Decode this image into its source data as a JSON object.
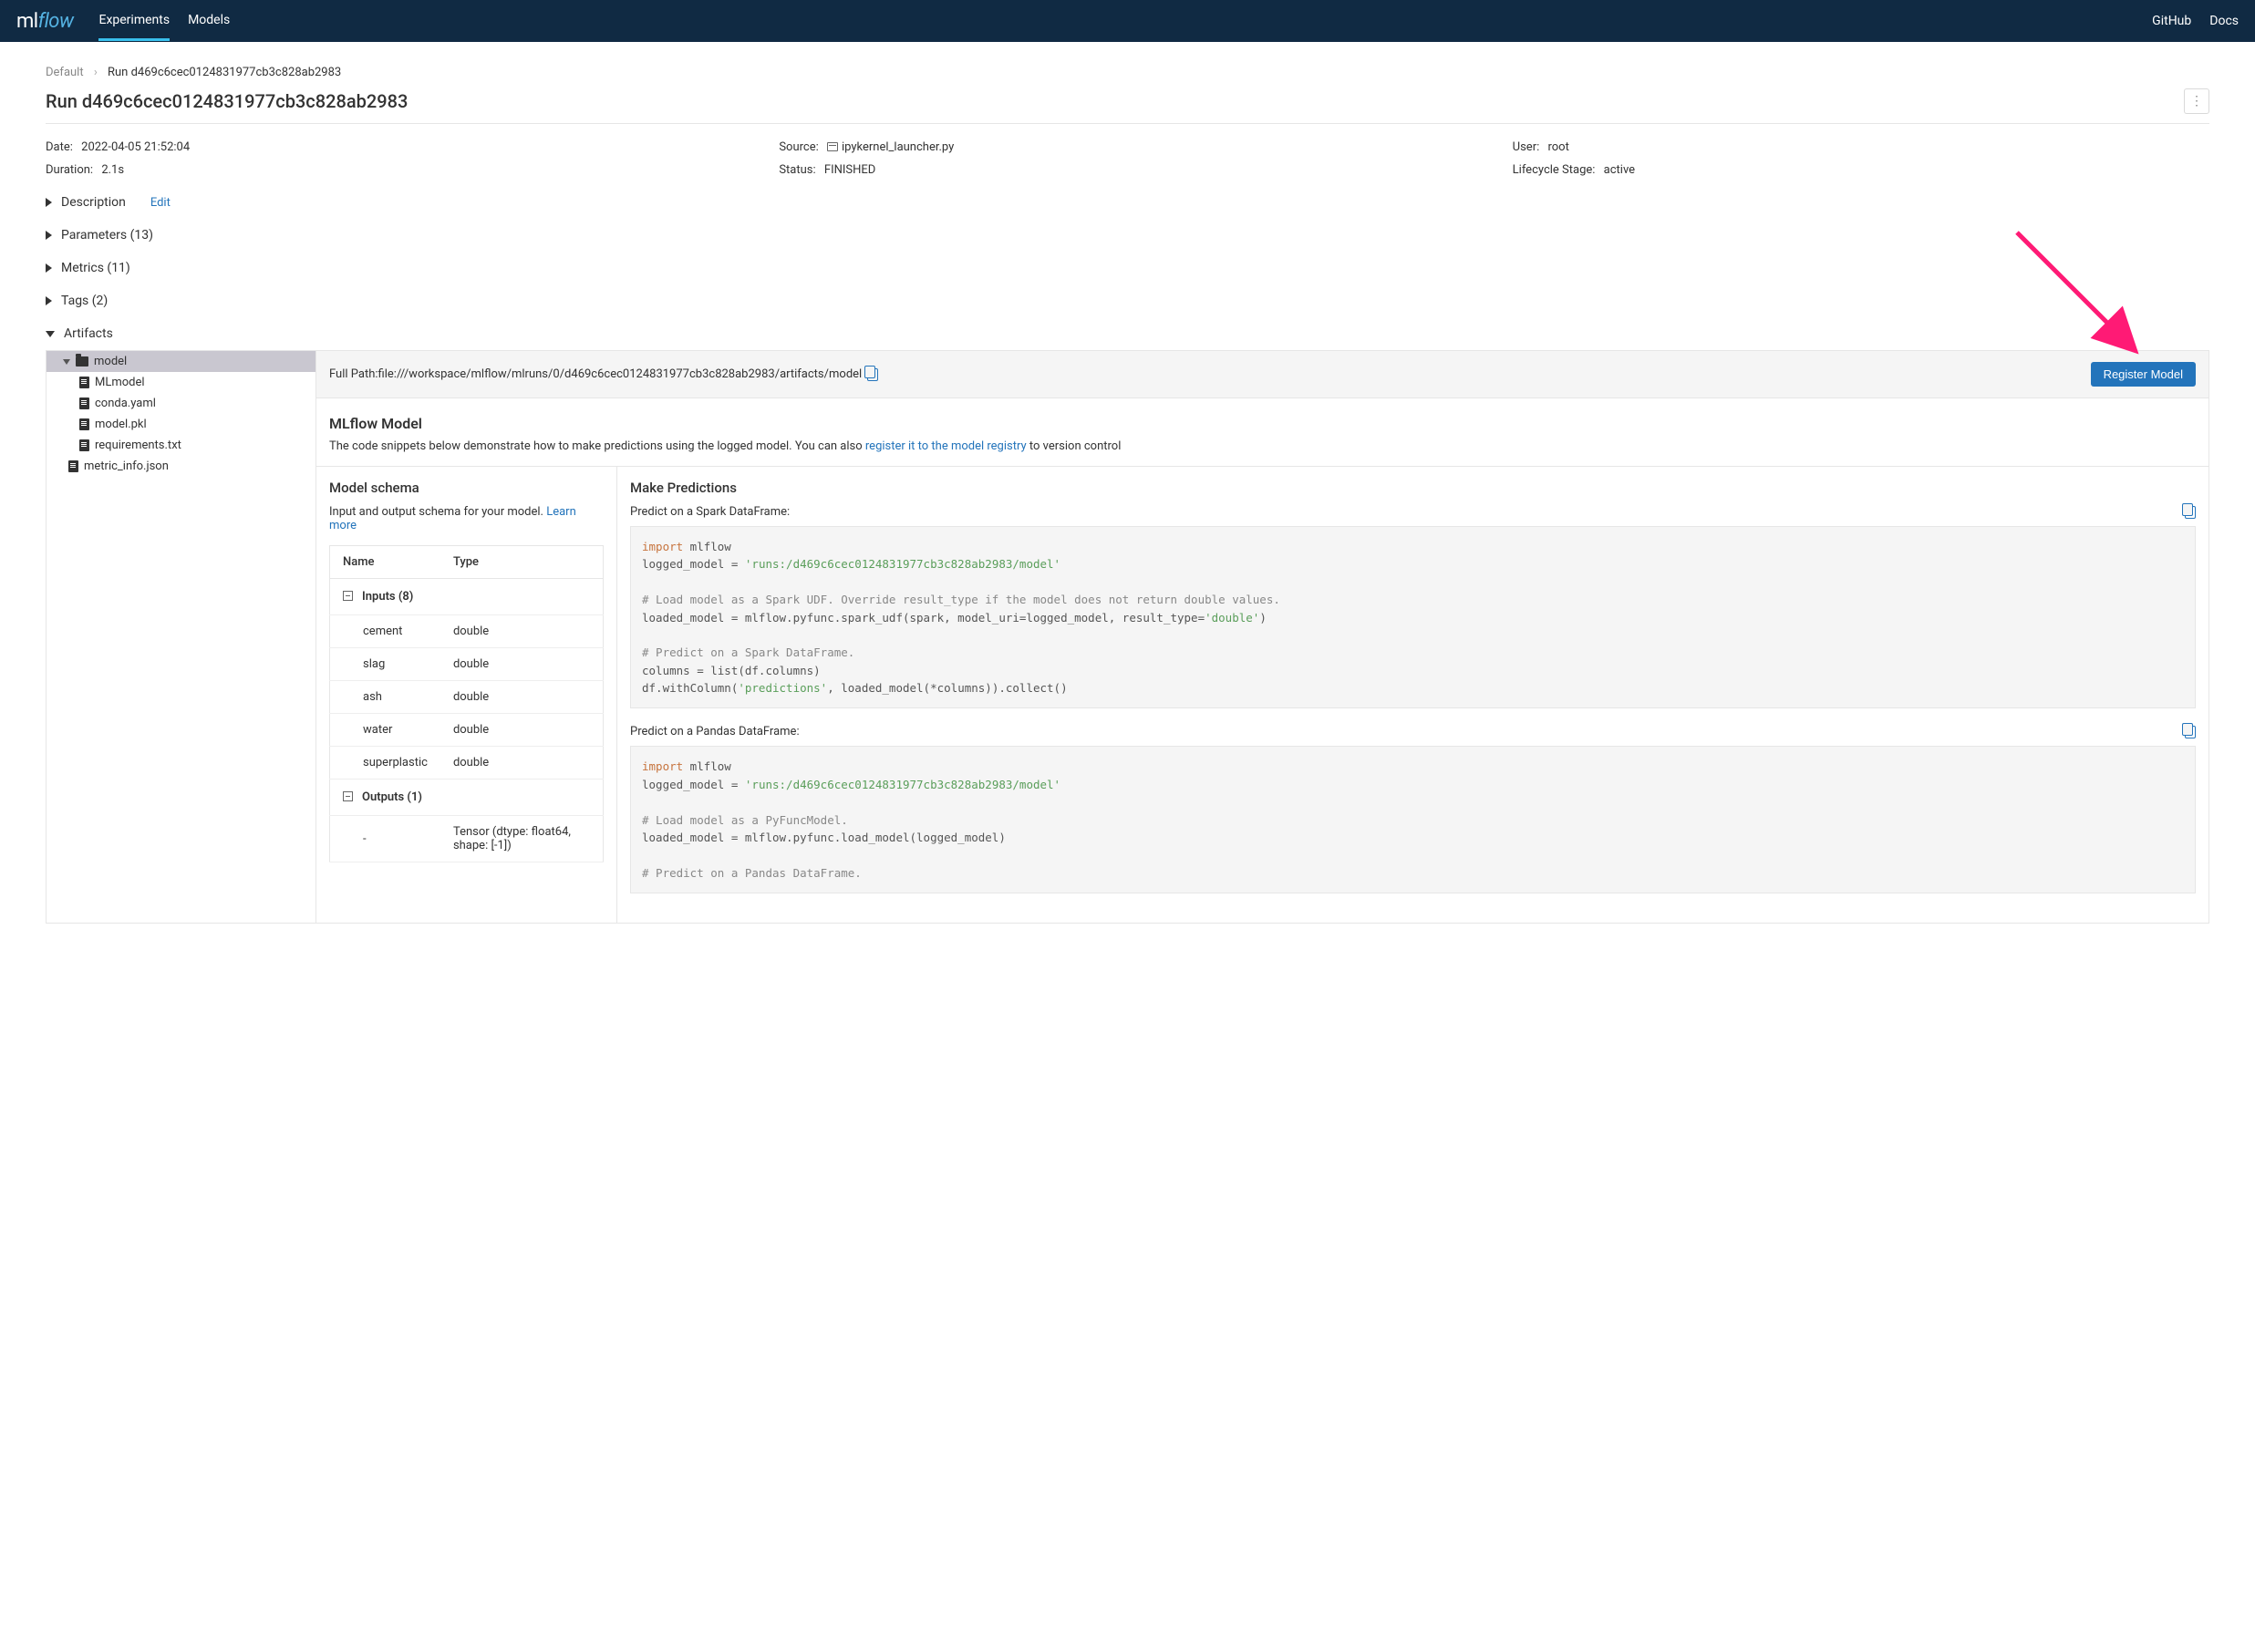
{
  "header": {
    "nav": {
      "experiments": "Experiments",
      "models": "Models"
    },
    "links": {
      "github": "GitHub",
      "docs": "Docs"
    }
  },
  "breadcrumb": {
    "root": "Default",
    "current": "Run d469c6cec0124831977cb3c828ab2983"
  },
  "page_title": "Run d469c6cec0124831977cb3c828ab2983",
  "meta": {
    "date_label": "Date:",
    "date": "2022-04-05 21:52:04",
    "source_label": "Source:",
    "source": "ipykernel_launcher.py",
    "user_label": "User:",
    "user": "root",
    "duration_label": "Duration:",
    "duration": "2.1s",
    "status_label": "Status:",
    "status": "FINISHED",
    "lifecycle_label": "Lifecycle Stage:",
    "lifecycle": "active"
  },
  "sections": {
    "description": "Description",
    "edit": "Edit",
    "parameters": "Parameters (13)",
    "metrics": "Metrics (11)",
    "tags": "Tags (2)",
    "artifacts": "Artifacts"
  },
  "tree": {
    "model": "model",
    "mlmodel": "MLmodel",
    "conda": "conda.yaml",
    "pkl": "model.pkl",
    "req": "requirements.txt",
    "metric_info": "metric_info.json"
  },
  "path": {
    "label": "Full Path:",
    "value": "file:///workspace/mlflow/mlruns/0/d469c6cec0124831977cb3c828ab2983/artifacts/model"
  },
  "register_btn": "Register Model",
  "model_panel": {
    "title": "MLflow Model",
    "desc_a": "The code snippets below demonstrate how to make predictions using the logged model. You can also ",
    "desc_link": "register it to the model registry",
    "desc_b": " to version control"
  },
  "schema": {
    "title": "Model schema",
    "sub_a": "Input and output schema for your model. ",
    "learn_more": "Learn more",
    "col_name": "Name",
    "col_type": "Type",
    "inputs_label": "Inputs (8)",
    "inputs": [
      {
        "name": "cement",
        "type": "double"
      },
      {
        "name": "slag",
        "type": "double"
      },
      {
        "name": "ash",
        "type": "double"
      },
      {
        "name": "water",
        "type": "double"
      },
      {
        "name": "superplastic",
        "type": "double"
      }
    ],
    "outputs_label": "Outputs (1)",
    "outputs": [
      {
        "name": "-",
        "type": "Tensor (dtype: float64, shape: [-1])"
      }
    ]
  },
  "predict": {
    "title": "Make Predictions",
    "spark_title": "Predict on a Spark DataFrame:",
    "pandas_title": "Predict on a Pandas DataFrame:",
    "model_uri": "'runs:/d469c6cec0124831977cb3c828ab2983/model'"
  }
}
